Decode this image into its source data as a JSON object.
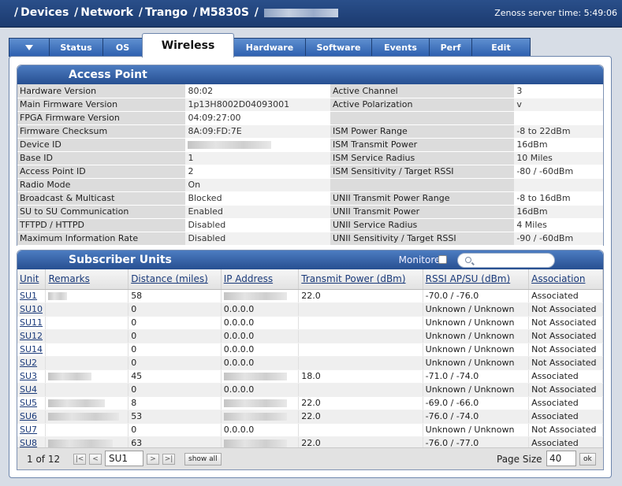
{
  "header": {
    "breadcrumb": [
      "Devices",
      "Network",
      "Trango",
      "M5830S"
    ],
    "server_time": "Zenoss server time: 5:49:06"
  },
  "tabs": [
    {
      "label": "▼",
      "active": false
    },
    {
      "label": "Status",
      "active": false
    },
    {
      "label": "OS",
      "active": false
    },
    {
      "label": "Wireless",
      "active": true
    },
    {
      "label": "Hardware",
      "active": false
    },
    {
      "label": "Software",
      "active": false
    },
    {
      "label": "Events",
      "active": false
    },
    {
      "label": "Perf",
      "active": false
    },
    {
      "label": "Edit",
      "active": false
    }
  ],
  "access_point": {
    "title": "Access Point",
    "rows": [
      {
        "l1": "Hardware Version",
        "v1": "80:02",
        "l2": "Active Channel",
        "v2": "3"
      },
      {
        "l1": "Main Firmware Version",
        "v1": "1p13H8002D04093001",
        "l2": "Active Polarization",
        "v2": "v"
      },
      {
        "l1": "FPGA Firmware Version",
        "v1": "04:09:27:00",
        "l2": "",
        "v2": ""
      },
      {
        "l1": "Firmware Checksum",
        "v1": "8A:09:FD:7E",
        "l2": "ISM Power Range",
        "v2": "-8 to 22dBm"
      },
      {
        "l1": "Device ID",
        "v1": "",
        "l2": "ISM Transmit Power",
        "v2": "16dBm"
      },
      {
        "l1": "Base ID",
        "v1": "1",
        "l2": "ISM Service Radius",
        "v2": "10 Miles"
      },
      {
        "l1": "Access Point ID",
        "v1": "2",
        "l2": "ISM Sensitivity / Target RSSI",
        "v2": "-80 / -60dBm"
      },
      {
        "l1": "Radio Mode",
        "v1": "On",
        "l2": "",
        "v2": ""
      },
      {
        "l1": "Broadcast & Multicast",
        "v1": "Blocked",
        "l2": "UNII Transmit Power Range",
        "v2": "-8 to 16dBm"
      },
      {
        "l1": "SU to SU Communication",
        "v1": "Enabled",
        "l2": "UNII Transmit Power",
        "v2": "16dBm"
      },
      {
        "l1": "TFTPD / HTTPD",
        "v1": "Disabled",
        "l2": "UNII Service Radius",
        "v2": "4 Miles"
      },
      {
        "l1": "Maximum Information Rate",
        "v1": "Disabled",
        "l2": "UNII Sensitivity / Target RSSI",
        "v2": "-90 / -60dBm"
      }
    ]
  },
  "subscriber_units": {
    "title": "Subscriber Units",
    "monitored_label": "Monitored",
    "columns": [
      "Unit",
      "Remarks",
      "Distance (miles)",
      "IP Address",
      "Transmit Power (dBm)",
      "RSSI AP/SU (dBm)",
      "Association"
    ],
    "rows": [
      {
        "unit": "SU1",
        "remarks_blur": true,
        "distance": "58",
        "ip": "",
        "ip_blur": true,
        "tx": "22.0",
        "rssi": "-70.0 / -76.0",
        "assoc": "Associated"
      },
      {
        "unit": "SU10",
        "remarks_blur": false,
        "distance": "0",
        "ip": "0.0.0.0",
        "ip_blur": false,
        "tx": "",
        "rssi": "Unknown / Unknown",
        "assoc": "Not Associated"
      },
      {
        "unit": "SU11",
        "remarks_blur": false,
        "distance": "0",
        "ip": "0.0.0.0",
        "ip_blur": false,
        "tx": "",
        "rssi": "Unknown / Unknown",
        "assoc": "Not Associated"
      },
      {
        "unit": "SU12",
        "remarks_blur": false,
        "distance": "0",
        "ip": "0.0.0.0",
        "ip_blur": false,
        "tx": "",
        "rssi": "Unknown / Unknown",
        "assoc": "Not Associated"
      },
      {
        "unit": "SU14",
        "remarks_blur": false,
        "distance": "0",
        "ip": "0.0.0.0",
        "ip_blur": false,
        "tx": "",
        "rssi": "Unknown / Unknown",
        "assoc": "Not Associated"
      },
      {
        "unit": "SU2",
        "remarks_blur": false,
        "distance": "0",
        "ip": "0.0.0.0",
        "ip_blur": false,
        "tx": "",
        "rssi": "Unknown / Unknown",
        "assoc": "Not Associated"
      },
      {
        "unit": "SU3",
        "remarks_blur": true,
        "distance": "45",
        "ip": "",
        "ip_blur": true,
        "tx": "18.0",
        "rssi": "-71.0 / -74.0",
        "assoc": "Associated"
      },
      {
        "unit": "SU4",
        "remarks_blur": false,
        "distance": "0",
        "ip": "0.0.0.0",
        "ip_blur": false,
        "tx": "",
        "rssi": "Unknown / Unknown",
        "assoc": "Not Associated"
      },
      {
        "unit": "SU5",
        "remarks_blur": true,
        "distance": "8",
        "ip": "",
        "ip_blur": true,
        "tx": "22.0",
        "rssi": "-69.0 / -66.0",
        "assoc": "Associated"
      },
      {
        "unit": "SU6",
        "remarks_blur": true,
        "distance": "53",
        "ip": "",
        "ip_blur": true,
        "tx": "22.0",
        "rssi": "-76.0 / -74.0",
        "assoc": "Associated"
      },
      {
        "unit": "SU7",
        "remarks_blur": false,
        "distance": "0",
        "ip": "0.0.0.0",
        "ip_blur": false,
        "tx": "",
        "rssi": "Unknown / Unknown",
        "assoc": "Not Associated"
      },
      {
        "unit": "SU8",
        "remarks_blur": true,
        "distance": "63",
        "ip": "",
        "ip_blur": true,
        "tx": "22.0",
        "rssi": "-76.0 / -77.0",
        "assoc": "Associated"
      }
    ],
    "pager": {
      "count_text": "1 of 12",
      "first": "|<",
      "prev": "<",
      "next": ">",
      "last": ">|",
      "current_value": "SU1",
      "show_all": "show all",
      "page_size_label": "Page Size",
      "page_size_value": "40",
      "ok": "ok"
    }
  }
}
